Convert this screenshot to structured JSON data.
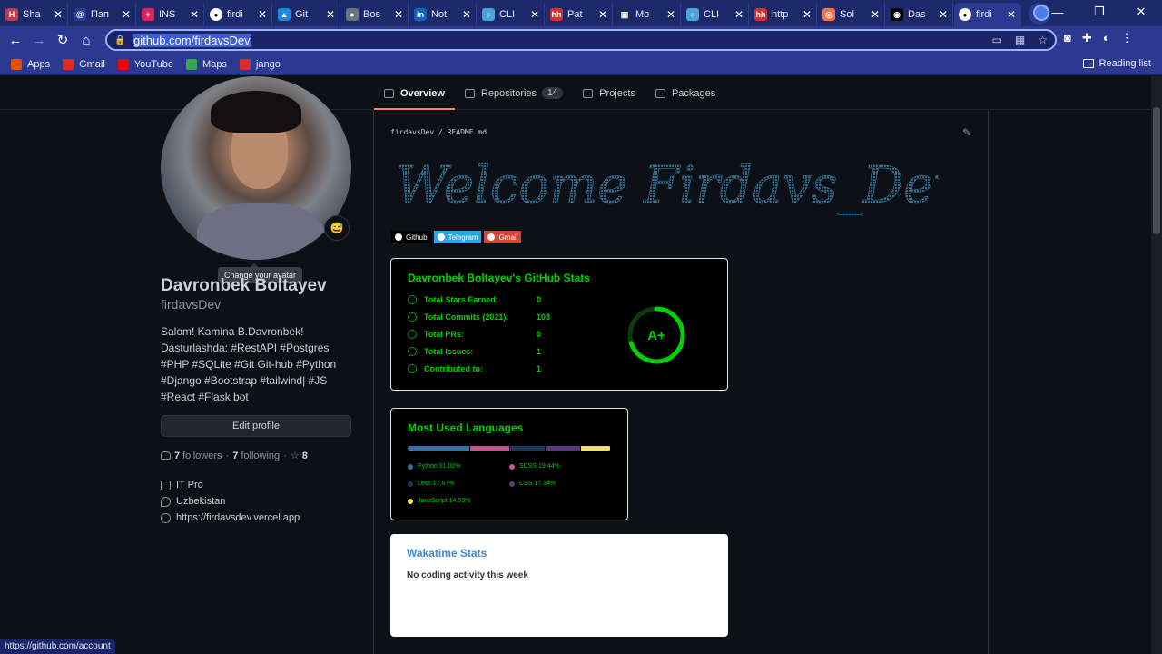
{
  "browser": {
    "tabs": [
      {
        "label": "Sha",
        "fav_color": "#c13b4a",
        "fav_glyph": "H",
        "icon": "site-icon"
      },
      {
        "label": "Пап",
        "fav_color": "#2b3990",
        "fav_glyph": "@",
        "icon": "at-icon"
      },
      {
        "label": "INS",
        "fav_color": "#e0245e",
        "fav_glyph": "+",
        "icon": "plus-icon"
      },
      {
        "label": "firdi",
        "fav_color": "#ffffff",
        "fav_glyph": "",
        "icon": "github-icon"
      },
      {
        "label": "Git",
        "fav_color": "#1e88e5",
        "fav_glyph": "▲",
        "icon": "azure-icon"
      },
      {
        "label": "Bos",
        "fav_color": "#6b7280",
        "fav_glyph": "●",
        "icon": "globe-icon"
      },
      {
        "label": "Not",
        "fav_color": "#0a66c2",
        "fav_glyph": "in",
        "icon": "linkedin-icon"
      },
      {
        "label": "CLI",
        "fav_color": "#4aa3df",
        "fav_glyph": "○",
        "icon": "circle-icon"
      },
      {
        "label": "Pat",
        "fav_color": "#d32f2f",
        "fav_glyph": "hh",
        "icon": "hh-icon"
      },
      {
        "label": "Mo",
        "fav_color": "#1f2a5f",
        "fav_glyph": "▣",
        "icon": "page-icon"
      },
      {
        "label": "CLI",
        "fav_color": "#4aa3df",
        "fav_glyph": "○",
        "icon": "circle-icon"
      },
      {
        "label": "http",
        "fav_color": "#d32f2f",
        "fav_glyph": "hh",
        "icon": "hh-icon"
      },
      {
        "label": "Sol",
        "fav_color": "#ff7043",
        "fav_glyph": "◎",
        "icon": "swirl-icon"
      },
      {
        "label": "Das",
        "fav_color": "#000000",
        "fav_glyph": "◉",
        "icon": "dash-icon"
      },
      {
        "label": "firdi",
        "fav_color": "#ffffff",
        "fav_glyph": "",
        "icon": "github-icon",
        "active": true
      }
    ],
    "url": "github.com/firdavsDev",
    "bookmarks": [
      {
        "label": "Apps",
        "color": "#e65100",
        "icon": "apps-grid-icon"
      },
      {
        "label": "Gmail",
        "color": "#d93025",
        "icon": "gmail-icon"
      },
      {
        "label": "YouTube",
        "color": "#ff0000",
        "icon": "youtube-icon"
      },
      {
        "label": "Maps",
        "color": "#34a853",
        "icon": "maps-pin-icon"
      },
      {
        "label": "jango",
        "color": "#d32f2f",
        "icon": "hh-icon"
      }
    ],
    "reading_list": "Reading list",
    "status_url": "https://github.com/account"
  },
  "profile_tabs": [
    {
      "label": "Overview",
      "selected": true,
      "icon": "book-icon"
    },
    {
      "label": "Repositories",
      "count": "14",
      "icon": "repo-icon"
    },
    {
      "label": "Projects",
      "icon": "project-icon"
    },
    {
      "label": "Packages",
      "icon": "package-icon"
    }
  ],
  "profile": {
    "tooltip": "Change your avatar",
    "name": "Davronbek Boltayev",
    "login": "firdavsDev",
    "bio": "Salom! Kamina B.Davronbek! Dasturlashda: #RestAPI #Postgres #PHP #SQLite #Git Git-hub #Python #Django #Bootstrap #tailwind| #JS #React #Flask bot",
    "edit_button": "Edit profile",
    "followers_count": "7",
    "followers_label": "followers",
    "following_count": "7",
    "following_label": "following",
    "stars_count": "8",
    "company": "IT Pro",
    "location": "Uzbekistan",
    "website": "https://firdavsdev.vercel.app"
  },
  "readme": {
    "breadcrumb_user": "firdavsDev",
    "breadcrumb_sep": "/",
    "breadcrumb_file": "README.md",
    "welcome_text": "Welcome Firdavs_Dev",
    "badges": [
      {
        "label": "Github",
        "bg": "#000000",
        "icon": "github-icon"
      },
      {
        "label": "Telegram",
        "bg": "#2ca5e0",
        "icon": "telegram-icon"
      },
      {
        "label": "Gmail",
        "bg": "#d14836",
        "icon": "gmail-icon"
      }
    ],
    "stats": {
      "title": "Davronbek Boltayev's GitHub Stats",
      "rows": [
        {
          "label": "Total Stars Earned:",
          "value": "0",
          "icon": "star-icon"
        },
        {
          "label": "Total Commits (2021):",
          "value": "103",
          "icon": "clock-icon"
        },
        {
          "label": "Total PRs:",
          "value": "0",
          "icon": "pr-icon"
        },
        {
          "label": "Total Issues:",
          "value": "1",
          "icon": "issue-icon"
        },
        {
          "label": "Contributed to:",
          "value": "1",
          "icon": "repo-icon"
        }
      ],
      "rank": "A+",
      "rank_progress": 0.7
    },
    "languages": {
      "title": "Most Used Languages",
      "items": [
        {
          "name": "Python",
          "pct": 31.02,
          "label": "Python 31.02%",
          "color": "#3572a5"
        },
        {
          "name": "SCSS",
          "pct": 19.44,
          "label": "SCSS 19.44%",
          "color": "#c6538c"
        },
        {
          "name": "Less",
          "pct": 17.67,
          "label": "Less 17.67%",
          "color": "#1d365d"
        },
        {
          "name": "CSS",
          "pct": 17.34,
          "label": "CSS 17.34%",
          "color": "#563d7c"
        },
        {
          "name": "JavaScript",
          "pct": 14.53,
          "label": "JavaScript 14.53%",
          "color": "#f1e05a"
        }
      ]
    },
    "wakatime": {
      "title": "Wakatime Stats",
      "message": "No coding activity this week"
    }
  }
}
